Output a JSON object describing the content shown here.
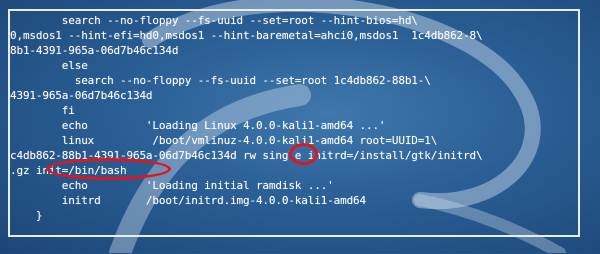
{
  "screen": {
    "lines": [
      "        search --no-floppy --fs-uuid --set=root --hint-bios=hd\\",
      "0,msdos1 --hint-efi=hd0,msdos1 --hint-baremetal=ahci0,msdos1  1c4db862-8\\",
      "8b1-4391-965a-06d7b46c134d",
      "        else",
      "          search --no-floppy --fs-uuid --set=root 1c4db862-88b1-\\",
      "4391-965a-06d7b46c134d",
      "        fi",
      "        echo         'Loading Linux 4.0.0-kali1-amd64 ...'",
      "        linux         /boot/vmlinuz-4.0.0-kali1-amd64 root=UUID=1\\",
      "c4db862-88b1-4391-965a-06d7b46c134d rw single initrd=/install/gtk/initrd\\",
      ".gz init=/bin/bash",
      "        echo         'Loading initial ramdisk ...'",
      "        initrd       /boot/initrd.img-4.0.0-kali1-amd64",
      "    }"
    ]
  },
  "colors": {
    "background": "#2a5e95",
    "text": "#ffffff",
    "frame": "#e6eef6",
    "annotation": "#e1151b"
  }
}
